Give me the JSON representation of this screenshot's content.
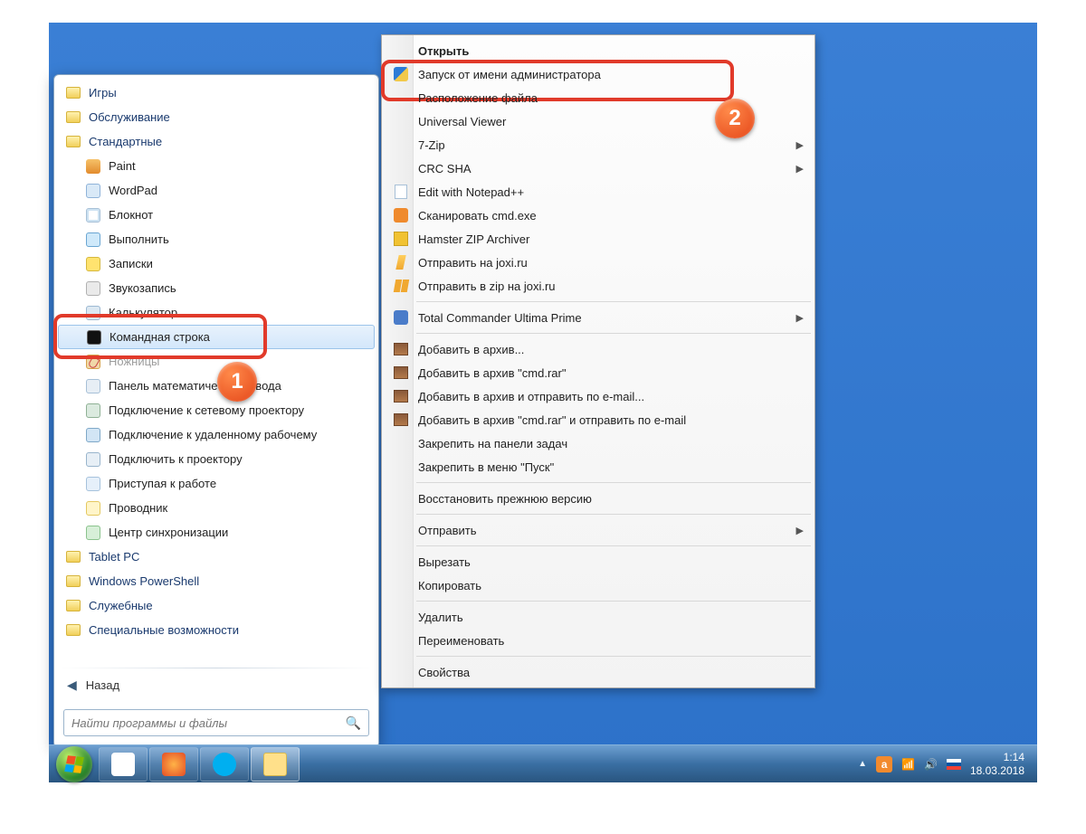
{
  "start_menu": {
    "items": [
      {
        "type": "folder",
        "label": "Игры",
        "icon": "folder-icon"
      },
      {
        "type": "folder",
        "label": "Обслуживание",
        "icon": "folder-icon"
      },
      {
        "type": "folder",
        "label": "Стандартные",
        "icon": "folder-icon"
      },
      {
        "type": "app",
        "label": "Paint",
        "icon": "gi-paint"
      },
      {
        "type": "app",
        "label": "WordPad",
        "icon": "gi-wordpad"
      },
      {
        "type": "app",
        "label": "Блокнот",
        "icon": "gi-notepad"
      },
      {
        "type": "app",
        "label": "Выполнить",
        "icon": "gi-run"
      },
      {
        "type": "app",
        "label": "Записки",
        "icon": "gi-notes"
      },
      {
        "type": "app",
        "label": "Звукозапись",
        "icon": "gi-rec"
      },
      {
        "type": "app",
        "label": "Калькулятор",
        "icon": "gi-calc",
        "truncated": true
      },
      {
        "type": "app",
        "label": "Командная строка",
        "icon": "gi-cmd",
        "selected": true
      },
      {
        "type": "app",
        "label": "Ножницы",
        "icon": "gi-snip",
        "dim": true
      },
      {
        "type": "app",
        "label": "Панель математического ввода",
        "icon": "gi-math",
        "obscured": "вода"
      },
      {
        "type": "app",
        "label": "Подключение к сетевому проектору",
        "icon": "gi-netproj"
      },
      {
        "type": "app",
        "label": "Подключение к удаленному рабочему",
        "icon": "gi-rdp"
      },
      {
        "type": "app",
        "label": "Подключить к проектору",
        "icon": "gi-proj"
      },
      {
        "type": "app",
        "label": "Приступая к работе",
        "icon": "gi-start"
      },
      {
        "type": "app",
        "label": "Проводник",
        "icon": "gi-explorer"
      },
      {
        "type": "app",
        "label": "Центр синхронизации",
        "icon": "gi-sync"
      },
      {
        "type": "folder",
        "label": "Tablet PC",
        "icon": "folder-icon"
      },
      {
        "type": "folder",
        "label": "Windows PowerShell",
        "icon": "folder-icon"
      },
      {
        "type": "folder",
        "label": "Служебные",
        "icon": "folder-icon"
      },
      {
        "type": "folder",
        "label": "Специальные возможности",
        "icon": "folder-icon"
      }
    ],
    "back_label": "Назад",
    "search_placeholder": "Найти программы и файлы"
  },
  "context_menu": {
    "groups": [
      [
        {
          "label": "Открыть",
          "bold": true
        },
        {
          "label": "Запуск от имени администратора",
          "icon": "ci-shield",
          "highlight": true
        },
        {
          "label": "Расположение файла"
        },
        {
          "label": "Universal Viewer"
        },
        {
          "label": "7-Zip",
          "submenu": true
        },
        {
          "label": "CRC SHA",
          "submenu": true
        },
        {
          "label": "Edit with Notepad++",
          "icon": "ci-edit"
        },
        {
          "label": "Сканировать cmd.exe",
          "icon": "ci-orange"
        },
        {
          "label": "Hamster ZIP Archiver",
          "icon": "ci-yellow"
        },
        {
          "label": "Отправить на joxi.ru",
          "icon": "ci-joxi1"
        },
        {
          "label": "Отправить в zip на joxi.ru",
          "icon": "ci-joxi2"
        }
      ],
      [
        {
          "label": "Total Commander Ultima Prime",
          "icon": "ci-tc",
          "submenu": true
        }
      ],
      [
        {
          "label": "Добавить в архив...",
          "icon": "ci-rar"
        },
        {
          "label": "Добавить в архив \"cmd.rar\"",
          "icon": "ci-rar"
        },
        {
          "label": "Добавить в архив и отправить по e-mail...",
          "icon": "ci-rar"
        },
        {
          "label": "Добавить в архив \"cmd.rar\" и отправить по e-mail",
          "icon": "ci-rar"
        },
        {
          "label": "Закрепить на панели задач"
        },
        {
          "label": "Закрепить в меню \"Пуск\""
        }
      ],
      [
        {
          "label": "Восстановить прежнюю версию"
        }
      ],
      [
        {
          "label": "Отправить",
          "submenu": true
        }
      ],
      [
        {
          "label": "Вырезать"
        },
        {
          "label": "Копировать"
        }
      ],
      [
        {
          "label": "Удалить"
        },
        {
          "label": "Переименовать"
        }
      ],
      [
        {
          "label": "Свойства"
        }
      ]
    ]
  },
  "callouts": {
    "badge1": "1",
    "badge2": "2"
  },
  "taskbar": {
    "buttons": [
      {
        "name": "panda",
        "icon": "tbi-panda"
      },
      {
        "name": "firefox",
        "icon": "tbi-firefox"
      },
      {
        "name": "skype",
        "icon": "tbi-skype"
      },
      {
        "name": "explorer",
        "icon": "tbi-explorer",
        "active": true
      }
    ],
    "tray": {
      "a_badge": "a",
      "time": "1:14",
      "date": "18.03.2018"
    }
  }
}
